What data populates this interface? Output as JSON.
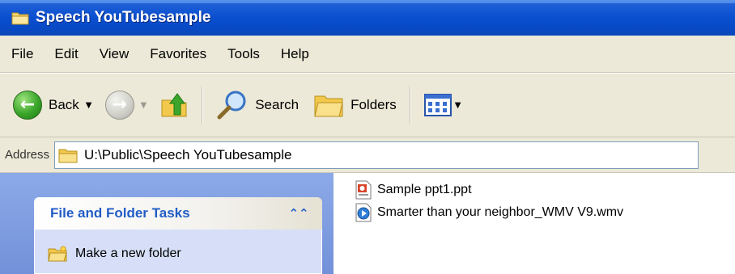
{
  "window": {
    "title": "Speech YouTubesample",
    "icon": "folder-icon"
  },
  "menubar": {
    "items": [
      "File",
      "Edit",
      "View",
      "Favorites",
      "Tools",
      "Help"
    ]
  },
  "toolbar": {
    "back_label": "Back",
    "search_label": "Search",
    "folders_label": "Folders"
  },
  "address": {
    "label": "Address",
    "value": "U:\\Public\\Speech YouTubesample"
  },
  "tasks": {
    "header": "File and Folder Tasks",
    "items": [
      "Make a new folder"
    ]
  },
  "files": [
    {
      "name": "Sample ppt1.ppt",
      "icon": "powerpoint-file-icon"
    },
    {
      "name": "Smarter than your neighbor_WMV V9.wmv",
      "icon": "media-file-icon"
    }
  ],
  "colors": {
    "titlebar": "#0a4fd0",
    "chrome": "#ece9d8",
    "task_pane": "#7391d9",
    "task_header_text": "#215dc6"
  }
}
